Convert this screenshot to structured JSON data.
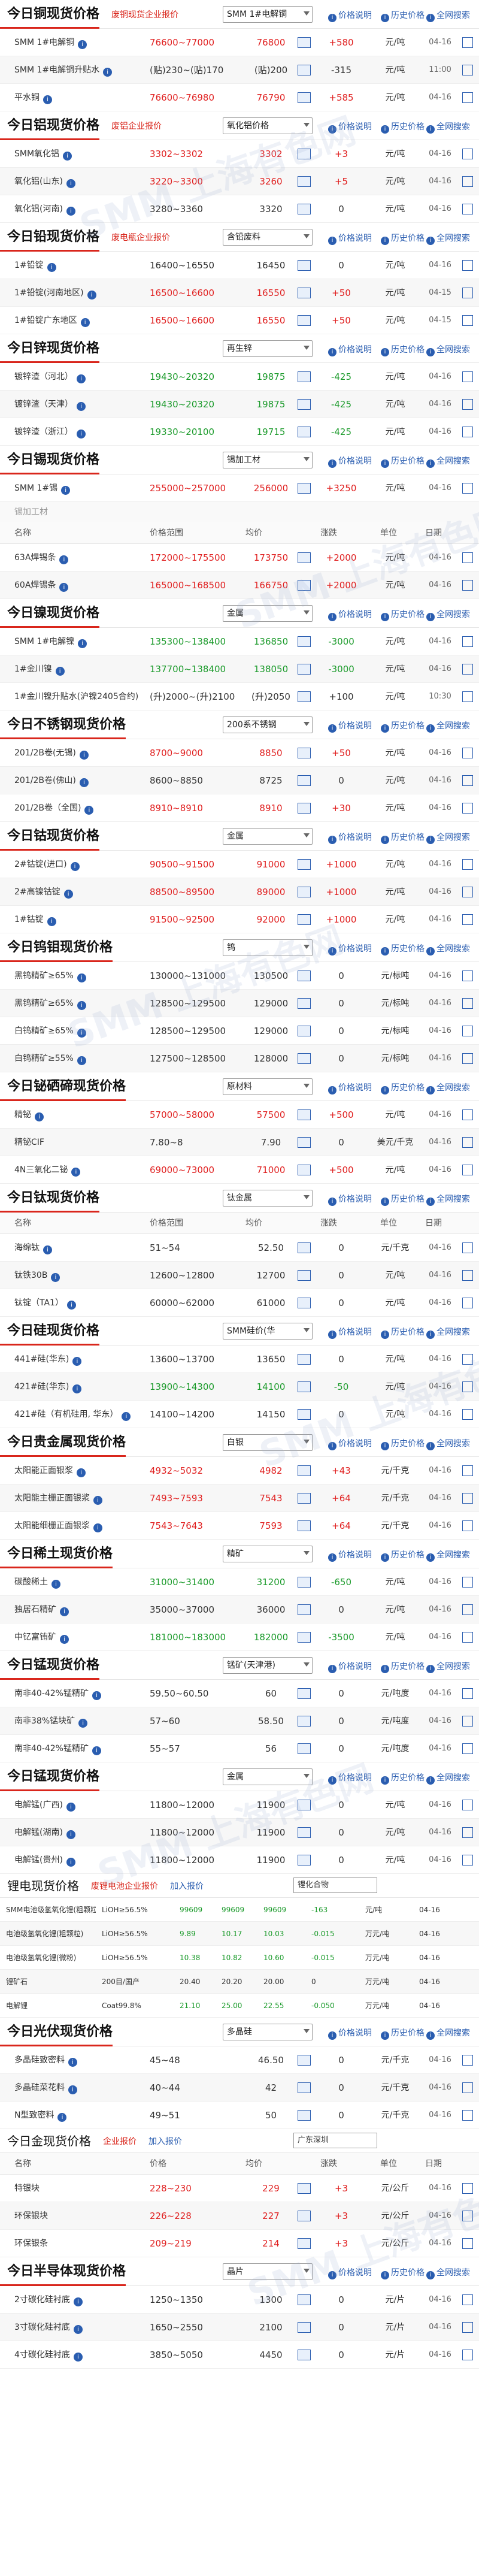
{
  "links": {
    "price_note": "价格说明",
    "history": "历史价格",
    "overview": "全网搜索"
  },
  "copper": {
    "title": "今日铜现货价格",
    "platform": "废铜现货企业报价",
    "select": "SMM 1#电解铜",
    "rows": [
      {
        "name": "SMM 1#电解铜",
        "range": "76600~77000",
        "avg": "76800",
        "change": "+580",
        "unit": "元/吨",
        "date": "04-16",
        "dir": "up",
        "info": true
      },
      {
        "name": "SMM 1#电解铜升贴水",
        "range": "(贴)230~(贴)170",
        "avg": "(贴)200",
        "change": "-315",
        "unit": "元/吨",
        "date": "11:00",
        "dir": "eq",
        "info": true
      },
      {
        "name": "平水铜",
        "range": "76600~76980",
        "avg": "76790",
        "change": "+585",
        "unit": "元/吨",
        "date": "04-16",
        "dir": "up",
        "info": true
      }
    ]
  },
  "alumina": {
    "title": "今日铝现货价格",
    "platform": "废铝企业报价",
    "select": "氧化铝价格",
    "rows": [
      {
        "name": "SMM氧化铝",
        "range": "3302~3302",
        "avg": "3302",
        "change": "+3",
        "unit": "元/吨",
        "date": "04-16",
        "dir": "up",
        "info": true
      },
      {
        "name": "氧化铝(山东)",
        "range": "3220~3300",
        "avg": "3260",
        "change": "+5",
        "unit": "元/吨",
        "date": "04-16",
        "dir": "up",
        "info": true
      },
      {
        "name": "氧化铝(河南)",
        "range": "3280~3360",
        "avg": "3320",
        "change": "0",
        "unit": "元/吨",
        "date": "04-16",
        "dir": "eq",
        "info": true
      }
    ]
  },
  "lead": {
    "title": "今日铅现货价格",
    "platform": "废电瓶企业报价",
    "select": "含铅废料",
    "rows": [
      {
        "name": "1#铅锭",
        "range": "16400~16550",
        "avg": "16450",
        "change": "0",
        "unit": "元/吨",
        "date": "04-16",
        "dir": "eq",
        "info": true
      },
      {
        "name": "1#铅锭(河南地区)",
        "range": "16500~16600",
        "avg": "16550",
        "change": "+50",
        "unit": "元/吨",
        "date": "04-15",
        "dir": "up",
        "info": true
      },
      {
        "name": "1#铅锭广东地区",
        "range": "16500~16600",
        "avg": "16550",
        "change": "+50",
        "unit": "元/吨",
        "date": "04-15",
        "dir": "up",
        "info": true
      }
    ]
  },
  "zinc": {
    "title": "今日锌现货价格",
    "select": "再生锌",
    "rows": [
      {
        "name": "镀锌渣（河北）",
        "range": "19430~20320",
        "avg": "19875",
        "change": "-425",
        "unit": "元/吨",
        "date": "04-16",
        "dir": "dn",
        "info": true
      },
      {
        "name": "镀锌渣（天津）",
        "range": "19430~20320",
        "avg": "19875",
        "change": "-425",
        "unit": "元/吨",
        "date": "04-16",
        "dir": "dn",
        "info": true
      },
      {
        "name": "镀锌渣（浙江）",
        "range": "19330~20100",
        "avg": "19715",
        "change": "-425",
        "unit": "元/吨",
        "date": "04-16",
        "dir": "dn",
        "info": true
      }
    ]
  },
  "tin": {
    "title": "今日锡现货价格",
    "select": "锡加工材",
    "rows": [
      {
        "name": "SMM 1#锡",
        "range": "255000~257000",
        "avg": "256000",
        "change": "+3250",
        "unit": "元/吨",
        "date": "04-16",
        "dir": "up",
        "info": true
      }
    ],
    "sub": "锡加工材",
    "cols": [
      "名称",
      "价格范围",
      "均价",
      "涨跌",
      "单位",
      "日期"
    ],
    "rows2": [
      {
        "name": "63A焊锡条",
        "range": "172000~175500",
        "avg": "173750",
        "change": "+2000",
        "unit": "元/吨",
        "date": "04-16",
        "dir": "up",
        "info": true
      },
      {
        "name": "60A焊锡条",
        "range": "165000~168500",
        "avg": "166750",
        "change": "+2000",
        "unit": "元/吨",
        "date": "04-16",
        "dir": "up",
        "info": true
      }
    ]
  },
  "nickel": {
    "title": "今日镍现货价格",
    "select": "金属",
    "rows": [
      {
        "name": "SMM 1#电解镍",
        "range": "135300~138400",
        "avg": "136850",
        "change": "-3000",
        "unit": "元/吨",
        "date": "04-16",
        "dir": "dn",
        "info": true
      },
      {
        "name": "1#金川镍",
        "range": "137700~138400",
        "avg": "138050",
        "change": "-3000",
        "unit": "元/吨",
        "date": "04-16",
        "dir": "dn",
        "info": true
      },
      {
        "name": "1#金川镍升贴水(沪镍2405合约)",
        "range": "(升)2000~(升)2100",
        "avg": "(升)2050",
        "change": "+100",
        "unit": "元/吨",
        "date": "10:30",
        "dir": "eq",
        "info": true
      }
    ]
  },
  "ss": {
    "title": "今日不锈钢现货价格",
    "select": "200系不锈钢",
    "rows": [
      {
        "name": "201/2B卷(无锡)",
        "range": "8700~9000",
        "avg": "8850",
        "change": "+50",
        "unit": "元/吨",
        "date": "04-16",
        "dir": "up",
        "info": true
      },
      {
        "name": "201/2B卷(佛山)",
        "range": "8600~8850",
        "avg": "8725",
        "change": "0",
        "unit": "元/吨",
        "date": "04-16",
        "dir": "eq",
        "info": true
      },
      {
        "name": "201/2B卷（全国)",
        "range": "8910~8910",
        "avg": "8910",
        "change": "+30",
        "unit": "元/吨",
        "date": "04-16",
        "dir": "up",
        "info": true
      }
    ]
  },
  "cobalt": {
    "title": "今日钴现货价格",
    "select": "金属",
    "rows": [
      {
        "name": "2#钴锭(进口)",
        "range": "90500~91500",
        "avg": "91000",
        "change": "+1000",
        "unit": "元/吨",
        "date": "04-16",
        "dir": "up",
        "info": true
      },
      {
        "name": "2#高镍钴锭",
        "range": "88500~89500",
        "avg": "89000",
        "change": "+1000",
        "unit": "元/吨",
        "date": "04-16",
        "dir": "up",
        "info": true
      },
      {
        "name": "1#钴锭",
        "range": "91500~92500",
        "avg": "92000",
        "change": "+1000",
        "unit": "元/吨",
        "date": "04-16",
        "dir": "up",
        "info": true
      }
    ]
  },
  "tungsten": {
    "title": "今日钨钼现货价格",
    "select": "钨",
    "rows": [
      {
        "name": "黑钨精矿≥65%",
        "range": "130000~131000",
        "avg": "130500",
        "change": "0",
        "unit": "元/标吨",
        "date": "04-16",
        "dir": "eq",
        "info": true
      },
      {
        "name": "黑钨精矿≥65%",
        "range": "128500~129500",
        "avg": "129000",
        "change": "0",
        "unit": "元/标吨",
        "date": "04-16",
        "dir": "eq",
        "info": true
      },
      {
        "name": "白钨精矿≥65%",
        "range": "128500~129500",
        "avg": "129000",
        "change": "0",
        "unit": "元/标吨",
        "date": "04-16",
        "dir": "eq",
        "info": true
      },
      {
        "name": "白钨精矿≥55%",
        "range": "127500~128500",
        "avg": "128000",
        "change": "0",
        "unit": "元/标吨",
        "date": "04-16",
        "dir": "eq",
        "info": true
      }
    ]
  },
  "bismuth": {
    "title": "今日铋硒碲现货价格",
    "select": "原材料",
    "rows": [
      {
        "name": "精铋",
        "range": "57000~58000",
        "avg": "57500",
        "change": "+500",
        "unit": "元/吨",
        "date": "04-16",
        "dir": "up",
        "info": true
      },
      {
        "name": "精铋CIF",
        "range": "7.80~8",
        "avg": "7.90",
        "change": "0",
        "unit": "美元/千克",
        "date": "04-16",
        "dir": "eq",
        "info": false
      },
      {
        "name": "4N三氧化二铋",
        "range": "69000~73000",
        "avg": "71000",
        "change": "+500",
        "unit": "元/吨",
        "date": "04-16",
        "dir": "up",
        "info": true
      }
    ]
  },
  "titanium": {
    "title": "今日钛现货价格",
    "select": "钛金属",
    "cols": [
      "名称",
      "价格范围",
      "均价",
      "涨跌",
      "单位",
      "日期"
    ],
    "rows": [
      {
        "name": "海绵钛",
        "range": "51~54",
        "avg": "52.50",
        "change": "0",
        "unit": "元/千克",
        "date": "04-16",
        "dir": "eq",
        "info": true
      },
      {
        "name": "钛铁30B",
        "range": "12600~12800",
        "avg": "12700",
        "change": "0",
        "unit": "元/吨",
        "date": "04-16",
        "dir": "eq",
        "info": true
      },
      {
        "name": "钛锭（TA1）",
        "range": "60000~62000",
        "avg": "61000",
        "change": "0",
        "unit": "元/吨",
        "date": "04-16",
        "dir": "eq",
        "info": true
      }
    ]
  },
  "silicon": {
    "title": "今日硅现货价格",
    "select": "SMM硅价(华",
    "rows": [
      {
        "name": "441#硅(华东)",
        "range": "13600~13700",
        "avg": "13650",
        "change": "0",
        "unit": "元/吨",
        "date": "04-16",
        "dir": "eq",
        "info": true
      },
      {
        "name": "421#硅(华东)",
        "range": "13900~14300",
        "avg": "14100",
        "change": "-50",
        "unit": "元/吨",
        "date": "04-16",
        "dir": "dn",
        "info": true
      },
      {
        "name": "421#硅（有机硅用, 华东）",
        "range": "14100~14200",
        "avg": "14150",
        "change": "0",
        "unit": "元/吨",
        "date": "04-16",
        "dir": "eq",
        "info": true
      }
    ]
  },
  "precious": {
    "title": "今日贵金属现货价格",
    "select": "白银",
    "rows": [
      {
        "name": "太阳能正面银浆",
        "range": "4932~5032",
        "avg": "4982",
        "change": "+43",
        "unit": "元/千克",
        "date": "04-16",
        "dir": "up",
        "info": true
      },
      {
        "name": "太阳能主栅正面银浆",
        "range": "7493~7593",
        "avg": "7543",
        "change": "+64",
        "unit": "元/千克",
        "date": "04-16",
        "dir": "up",
        "info": true
      },
      {
        "name": "太阳能细栅正面银浆",
        "range": "7543~7643",
        "avg": "7593",
        "change": "+64",
        "unit": "元/千克",
        "date": "04-16",
        "dir": "up",
        "info": true
      }
    ]
  },
  "rare": {
    "title": "今日稀土现货价格",
    "select": "精矿",
    "rows": [
      {
        "name": "碳酸稀土",
        "range": "31000~31400",
        "avg": "31200",
        "change": "-650",
        "unit": "元/吨",
        "date": "04-16",
        "dir": "dn",
        "info": true
      },
      {
        "name": "独居石精矿",
        "range": "35000~37000",
        "avg": "36000",
        "change": "0",
        "unit": "元/吨",
        "date": "04-16",
        "dir": "eq",
        "info": true
      },
      {
        "name": "中钇富铕矿",
        "range": "181000~183000",
        "avg": "182000",
        "change": "-3500",
        "unit": "元/吨",
        "date": "04-16",
        "dir": "dn",
        "info": true
      }
    ]
  },
  "manganese_ore": {
    "title": "今日锰现货价格",
    "select": "锰矿(天津港)",
    "rows": [
      {
        "name": "南非40-42%锰精矿",
        "range": "59.50~60.50",
        "avg": "60",
        "change": "0",
        "unit": "元/吨度",
        "date": "04-16",
        "dir": "eq",
        "info": true
      },
      {
        "name": "南非38%锰块矿",
        "range": "57~60",
        "avg": "58.50",
        "change": "0",
        "unit": "元/吨度",
        "date": "04-16",
        "dir": "eq",
        "info": true
      },
      {
        "name": "南非40-42%锰精矿",
        "range": "55~57",
        "avg": "56",
        "change": "0",
        "unit": "元/吨度",
        "date": "04-16",
        "dir": "eq",
        "info": true
      }
    ]
  },
  "manganese": {
    "title": "今日锰现货价格",
    "select": "金属",
    "rows": [
      {
        "name": "电解锰(广西)",
        "range": "11800~12000",
        "avg": "11900",
        "change": "0",
        "unit": "元/吨",
        "date": "04-16",
        "dir": "eq",
        "info": true
      },
      {
        "name": "电解锰(湖南)",
        "range": "11800~12000",
        "avg": "11900",
        "change": "0",
        "unit": "元/吨",
        "date": "04-16",
        "dir": "eq",
        "info": true
      },
      {
        "name": "电解锰(贵州)",
        "range": "11800~12000",
        "avg": "11900",
        "change": "0",
        "unit": "元/吨",
        "date": "04-16",
        "dir": "eq",
        "info": true
      }
    ]
  },
  "lithium": {
    "title": "锂电现货价格",
    "l1": "废锂电池企业报价",
    "l2": "加入报价",
    "select": "锂化合物",
    "rows": [
      {
        "name": "SMM电池级氢氧化锂(粗颗粒)",
        "spec": "LiOH≥56.5%",
        "a": "99609",
        "b": "99609",
        "c": "99609",
        "chg": "-163",
        "unit": "元/吨",
        "date": "04-16",
        "dir": "dn"
      },
      {
        "name": "电池级氢氧化锂(粗颗粒)",
        "spec": "LiOH≥56.5%",
        "a": "9.89",
        "b": "10.17",
        "c": "10.03",
        "chg": "-0.015",
        "unit": "万元/吨",
        "date": "04-16",
        "dir": "dn"
      },
      {
        "name": "电池级氢氧化锂(微粉)",
        "spec": "LiOH≥56.5%",
        "a": "10.38",
        "b": "10.82",
        "c": "10.60",
        "chg": "-0.015",
        "unit": "万元/吨",
        "date": "04-16",
        "dir": "dn"
      },
      {
        "name": "锂矿石",
        "spec": "200目/国产",
        "a": "20.40",
        "b": "20.20",
        "c": "20.00",
        "chg": "0",
        "unit": "万元/吨",
        "date": "04-16",
        "dir": "eq"
      },
      {
        "name": "电解锂",
        "spec": "Coat99.8%",
        "a": "21.10",
        "b": "25.00",
        "c": "22.55",
        "chg": "-0.050",
        "unit": "万元/吨",
        "date": "04-16",
        "dir": "dn"
      }
    ]
  },
  "pv": {
    "title": "今日光伏现货价格",
    "select": "多晶硅",
    "rows": [
      {
        "name": "多晶硅致密料",
        "range": "45~48",
        "avg": "46.50",
        "change": "0",
        "unit": "元/千克",
        "date": "04-16",
        "dir": "eq",
        "info": true
      },
      {
        "name": "多晶硅菜花料",
        "range": "40~44",
        "avg": "42",
        "change": "0",
        "unit": "元/千克",
        "date": "04-16",
        "dir": "eq",
        "info": true
      },
      {
        "name": "N型致密料",
        "range": "49~51",
        "avg": "50",
        "change": "0",
        "unit": "元/千克",
        "date": "04-16",
        "dir": "eq",
        "info": true
      }
    ]
  },
  "gold_local": {
    "title": "今日金现货价格",
    "l1": "企业报价",
    "l2": "加入报价",
    "select": "广东深圳",
    "cols": [
      "名称",
      "价格",
      "均价",
      "涨跌",
      "单位",
      "日期"
    ],
    "rows": [
      {
        "name": "特银块",
        "range": "228~230",
        "avg": "229",
        "change": "+3",
        "unit": "元/公斤",
        "date": "04-16",
        "dir": "up"
      },
      {
        "name": "环保银块",
        "range": "226~228",
        "avg": "227",
        "change": "+3",
        "unit": "元/公斤",
        "date": "04-16",
        "dir": "up"
      },
      {
        "name": "环保银条",
        "range": "209~219",
        "avg": "214",
        "change": "+3",
        "unit": "元/公斤",
        "date": "04-16",
        "dir": "up"
      }
    ]
  },
  "semi": {
    "title": "今日半导体现货价格",
    "select": "晶片",
    "rows": [
      {
        "name": "2寸碳化硅衬底",
        "range": "1250~1350",
        "avg": "1300",
        "change": "0",
        "unit": "元/片",
        "date": "04-16",
        "dir": "eq",
        "info": true
      },
      {
        "name": "3寸碳化硅衬底",
        "range": "1650~2550",
        "avg": "2100",
        "change": "0",
        "unit": "元/片",
        "date": "04-16",
        "dir": "eq",
        "info": true
      },
      {
        "name": "4寸碳化硅衬底",
        "range": "3850~5050",
        "avg": "4450",
        "change": "0",
        "unit": "元/片",
        "date": "04-16",
        "dir": "eq",
        "info": true
      }
    ]
  },
  "watermark": "SMM 上海有色网"
}
